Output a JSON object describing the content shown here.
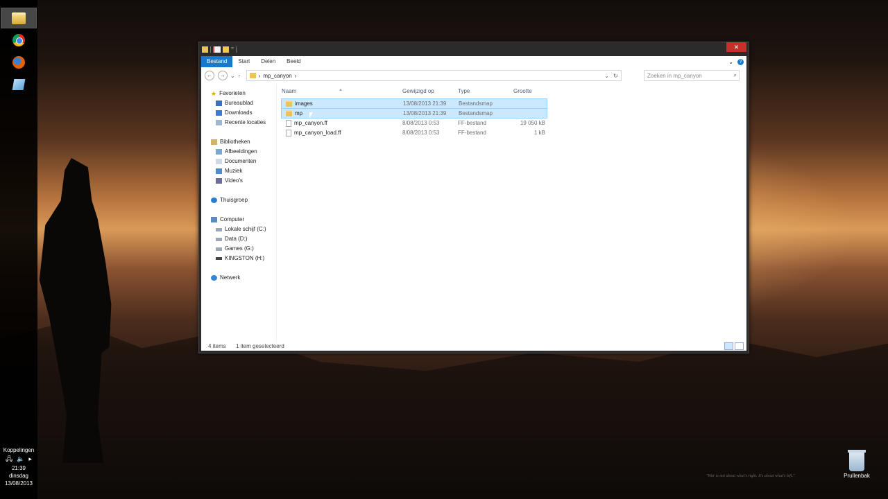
{
  "taskbar": {
    "apps": [
      {
        "name": "file-explorer",
        "icon": "folder-icon"
      },
      {
        "name": "chrome",
        "icon": "chrome-icon"
      },
      {
        "name": "firefox",
        "icon": "firefox-icon"
      },
      {
        "name": "paper",
        "icon": "paper-icon"
      }
    ],
    "tray": {
      "links_label": "Koppelingen",
      "time": "21:39",
      "day": "dinsdag",
      "date": "13/08/2013"
    }
  },
  "desktop": {
    "recycle_bin_label": "Prullenbak",
    "quote": "\"War is not about what's right. It's about what's left.\""
  },
  "explorer": {
    "ribbon_tabs": [
      "Bestand",
      "Start",
      "Delen",
      "Beeld"
    ],
    "address": {
      "path": "mp_canyon"
    },
    "search_placeholder": "Zoeken in mp_canyon",
    "nav": {
      "favorites": {
        "label": "Favorieten",
        "items": [
          "Bureaublad",
          "Downloads",
          "Recente locaties"
        ]
      },
      "libraries": {
        "label": "Bibliotheken",
        "items": [
          "Afbeeldingen",
          "Documenten",
          "Muziek",
          "Video's"
        ]
      },
      "homegroup": {
        "label": "Thuisgroep"
      },
      "computer": {
        "label": "Computer",
        "items": [
          "Lokale schijf (C:)",
          "Data (D:)",
          "Games (G:)",
          "KINGSTON (H:)"
        ]
      },
      "network": {
        "label": "Netwerk"
      }
    },
    "columns": {
      "name": "Naam",
      "modified": "Gewijzigd op",
      "type": "Type",
      "size": "Grootte"
    },
    "files": [
      {
        "name": "images",
        "modified": "13/08/2013 21:39",
        "type": "Bestandsmap",
        "size": "",
        "kind": "folder",
        "selected": true
      },
      {
        "name": "mp",
        "modified": "13/08/2013 21:39",
        "type": "Bestandsmap",
        "size": "",
        "kind": "folder",
        "selected": true
      },
      {
        "name": "mp_canyon.ff",
        "modified": "8/08/2013 0:53",
        "type": "FF-bestand",
        "size": "19 050 kB",
        "kind": "file",
        "selected": false
      },
      {
        "name": "mp_canyon_load.ff",
        "modified": "8/08/2013 0:53",
        "type": "FF-bestand",
        "size": "1 kB",
        "kind": "file",
        "selected": false
      }
    ],
    "status": {
      "count": "4 items",
      "selection": "1 item geselecteerd"
    }
  }
}
